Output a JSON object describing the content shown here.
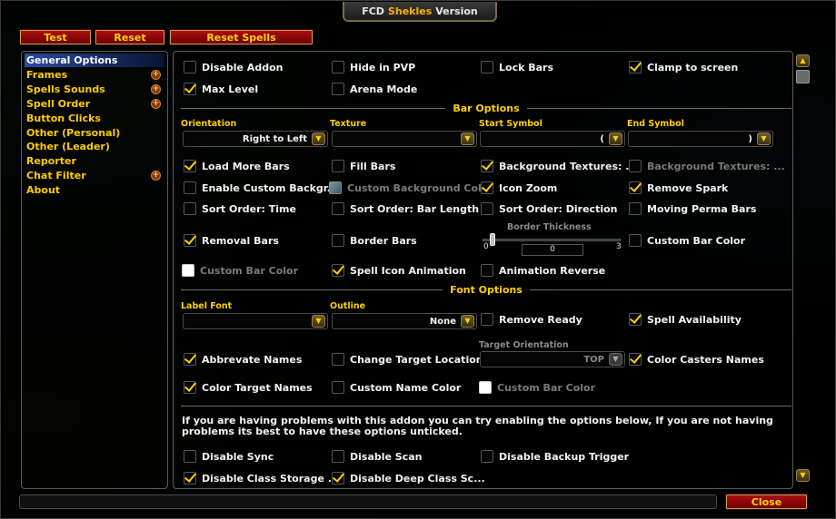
{
  "title": {
    "prefix": "FCD",
    "accent": "Shekles",
    "suffix": "Version"
  },
  "top_buttons": {
    "test": "Test",
    "reset": "Reset",
    "reset_spells": "Reset Spells"
  },
  "close_label": "Close",
  "nav": {
    "selected": "General Options",
    "items": [
      {
        "label": "General Options",
        "expandable": false
      },
      {
        "label": "Frames",
        "expandable": true
      },
      {
        "label": "Spells Sounds",
        "expandable": true
      },
      {
        "label": "Spell Order",
        "expandable": true
      },
      {
        "label": "Button Clicks",
        "expandable": false
      },
      {
        "label": "Other (Personal)",
        "expandable": false
      },
      {
        "label": "Other (Leader)",
        "expandable": false
      },
      {
        "label": "Reporter",
        "expandable": false
      },
      {
        "label": "Chat Filter",
        "expandable": true
      },
      {
        "label": "About",
        "expandable": false
      }
    ]
  },
  "general": {
    "disable_addon": {
      "label": "Disable Addon",
      "checked": false
    },
    "hide_in_pvp": {
      "label": "Hide in PVP",
      "checked": false
    },
    "lock_bars": {
      "label": "Lock Bars",
      "checked": false
    },
    "clamp_to_screen": {
      "label": "Clamp to screen",
      "checked": true
    },
    "max_level": {
      "label": "Max Level",
      "checked": true
    },
    "arena_mode": {
      "label": "Arena Mode",
      "checked": false
    }
  },
  "bar_options": {
    "heading": "Bar Options",
    "orientation": {
      "label": "Orientation",
      "value": "Right to Left"
    },
    "texture": {
      "label": "Texture",
      "value": ""
    },
    "start_symbol": {
      "label": "Start Symbol",
      "value": "("
    },
    "end_symbol": {
      "label": "End Symbol",
      "value": ")"
    },
    "load_more_bars": {
      "label": "Load More Bars",
      "checked": true
    },
    "fill_bars": {
      "label": "Fill Bars",
      "checked": false
    },
    "background_textures": {
      "label": "Background Textures: ...",
      "checked": true
    },
    "background_textures_2": {
      "label": "Background Textures: ...",
      "checked": false
    },
    "enable_custom_background": {
      "label": "Enable Custom Backgr...",
      "checked": false
    },
    "custom_background_color": {
      "label": "Custom Background Col..."
    },
    "icon_zoom": {
      "label": "Icon Zoom",
      "checked": true
    },
    "remove_spark": {
      "label": "Remove Spark",
      "checked": true
    },
    "sort_time": {
      "label": "Sort Order: Time",
      "checked": false
    },
    "sort_bar_length": {
      "label": "Sort Order: Bar Length",
      "checked": false
    },
    "sort_direction": {
      "label": "Sort Order: Direction",
      "checked": false
    },
    "moving_perma_bars": {
      "label": "Moving Perma Bars",
      "checked": false
    },
    "removal_bars": {
      "label": "Removal Bars",
      "checked": true
    },
    "border_bars": {
      "label": "Border Bars",
      "checked": false
    },
    "border_thickness": {
      "label": "Border Thickness",
      "min": "0",
      "max": "3",
      "value": "0"
    },
    "custom_bar_color": {
      "label": "Custom Bar Color",
      "checked": false
    },
    "custom_bar_color_swatch": {
      "label": "Custom Bar Color"
    },
    "spell_icon_animation": {
      "label": "Spell Icon Animation",
      "checked": true
    },
    "animation_reverse": {
      "label": "Animation Reverse",
      "checked": false
    }
  },
  "font_options": {
    "heading": "Font Options",
    "label_font": {
      "label": "Label Font",
      "value": ""
    },
    "outline": {
      "label": "Outline",
      "value": "None"
    },
    "remove_ready": {
      "label": "Remove Ready",
      "checked": false
    },
    "spell_availability": {
      "label": "Spell Availability",
      "checked": true
    },
    "abbrevate_names": {
      "label": "Abbrevate Names",
      "checked": true
    },
    "change_target_location": {
      "label": "Change Target Location",
      "checked": false
    },
    "target_orientation": {
      "label": "Target Orientation",
      "value": "TOP"
    },
    "color_casters_names": {
      "label": "Color Casters Names",
      "checked": true
    },
    "color_target_names": {
      "label": "Color Target Names",
      "checked": true
    },
    "custom_name_color": {
      "label": "Custom Name Color",
      "checked": false
    },
    "custom_bar_color_swatch": {
      "label": "Custom Bar Color"
    }
  },
  "troubleshooting": {
    "info": "If you are having problems with this addon you can try enabling the options below, If you are not having problems its best to have these options unticked.",
    "disable_sync": {
      "label": "Disable Sync",
      "checked": false
    },
    "disable_scan": {
      "label": "Disable Scan",
      "checked": false
    },
    "disable_backup_trigger": {
      "label": "Disable Backup Trigger",
      "checked": false
    },
    "disable_class_storage": {
      "label": "Disable Class Storage ...",
      "checked": true
    },
    "disable_deep_class_scan": {
      "label": "Disable Deep Class Sc...",
      "checked": true
    }
  },
  "colors": {
    "accent": "#ffd000",
    "button_red": "#b01010",
    "selected_nav": "#2a4aa0"
  }
}
